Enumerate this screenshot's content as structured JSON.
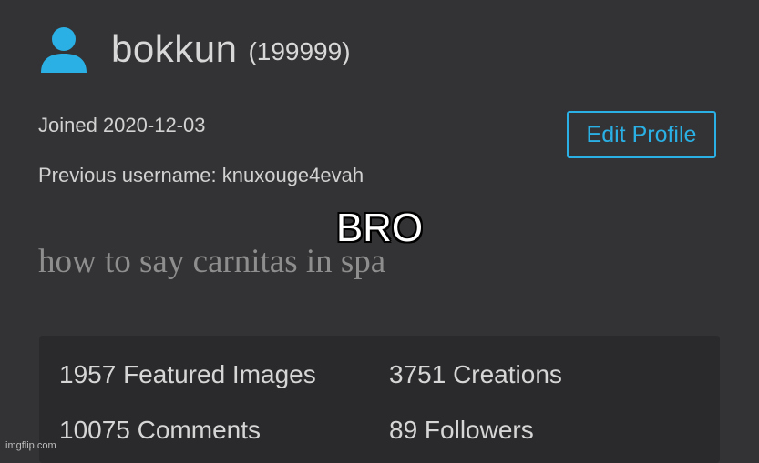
{
  "profile": {
    "icon": "user-icon",
    "username": "bokkun",
    "points": "(199999)",
    "joined": "Joined 2020-12-03",
    "previous_username": "Previous username: knuxouge4evah",
    "edit_button": "Edit Profile",
    "bio": "how to say carnitas in spa"
  },
  "meme_caption": "BRO",
  "stats": [
    {
      "label": "1957 Featured Images"
    },
    {
      "label": "3751 Creations"
    },
    {
      "label": "10075 Comments"
    },
    {
      "label": "89 Followers"
    }
  ],
  "watermark": "imgflip.com",
  "colors": {
    "background": "#333335",
    "accent": "#2ab0e4",
    "panel": "#2a2a2c",
    "bio_text": "#8e8e8e"
  }
}
